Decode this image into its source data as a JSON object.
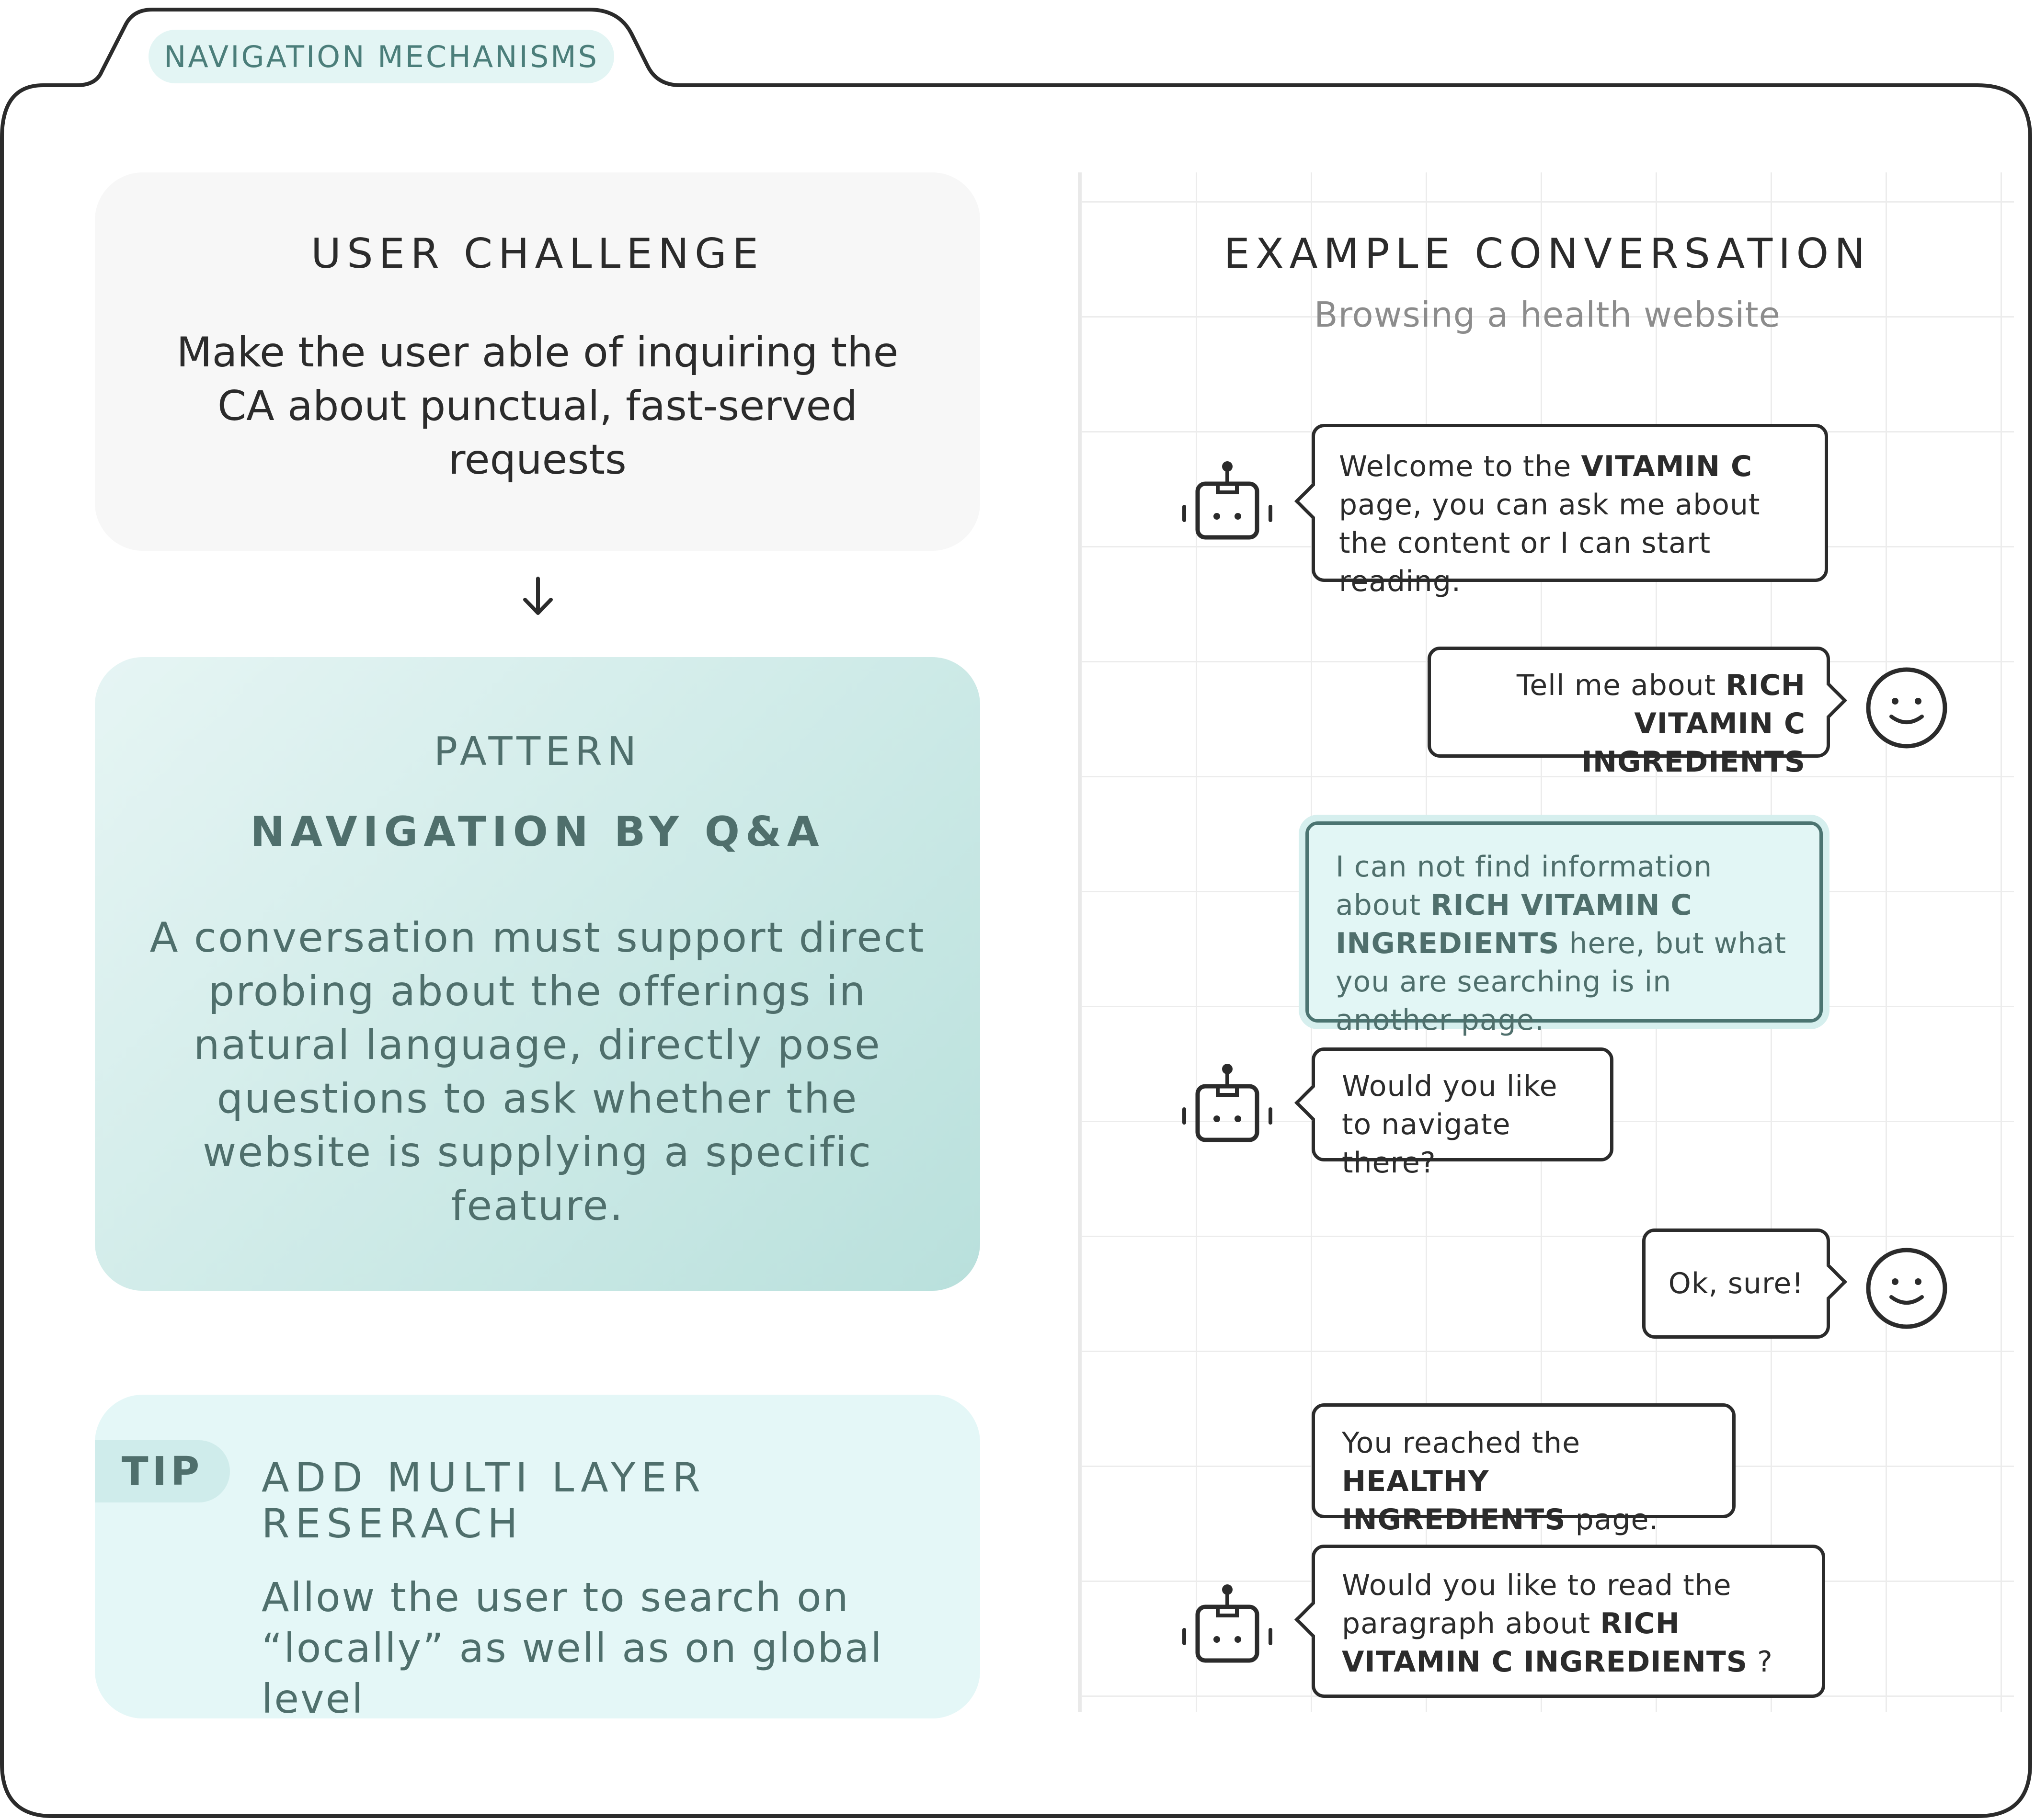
{
  "tab": {
    "label": "NAVIGATION MECHANISMS"
  },
  "user_challenge": {
    "heading": "USER CHALLENGE",
    "body": "Make the user able of inquiring the CA about punctual, fast-served requests"
  },
  "pattern": {
    "kicker": "PATTERN",
    "title": "NAVIGATION BY Q&A",
    "body": "A conversation must support direct probing about the offerings in natural language, directly pose questions to ask whether the website is supplying a specific feature."
  },
  "tip": {
    "badge": "TIP",
    "title": "ADD MULTI LAYER RESERACH",
    "body": "Allow the user to search on “locally” as well as on global level"
  },
  "conversation": {
    "heading": "EXAMPLE CONVERSATION",
    "subtitle": "Browsing a health website",
    "messages": [
      {
        "speaker": "bot",
        "parts": [
          "Welcome to the ",
          "VITAMIN C",
          " page, you can ask me about the content or I can start reading."
        ]
      },
      {
        "speaker": "user",
        "parts": [
          "Tell me about ",
          "RICH VITAMIN C INGREDIENTS",
          ""
        ]
      },
      {
        "speaker": "bot",
        "parts": [
          "I can not find information about ",
          "RICH VITAMIN C INGREDIENTS",
          " here, but what you are searching is in another page."
        ]
      },
      {
        "speaker": "bot",
        "parts": [
          "Would you like to navigate there?"
        ]
      },
      {
        "speaker": "user",
        "parts": [
          "Ok, sure!"
        ]
      },
      {
        "speaker": "bot",
        "parts": [
          "You reached the ",
          "HEALTHY INGREDIENTS",
          " page."
        ]
      },
      {
        "speaker": "bot",
        "parts": [
          "Would you like to read the paragraph about  ",
          "RICH VITAMIN C INGREDIENTS",
          " ?"
        ]
      }
    ]
  },
  "icons": {
    "arrow": "arrow-down-icon",
    "bot": "robot-icon",
    "user": "smiley-face-icon"
  },
  "colors": {
    "accent": "#4f6f6c",
    "teal_light": "#e4f7f7",
    "outline": "#2b2b2b"
  }
}
